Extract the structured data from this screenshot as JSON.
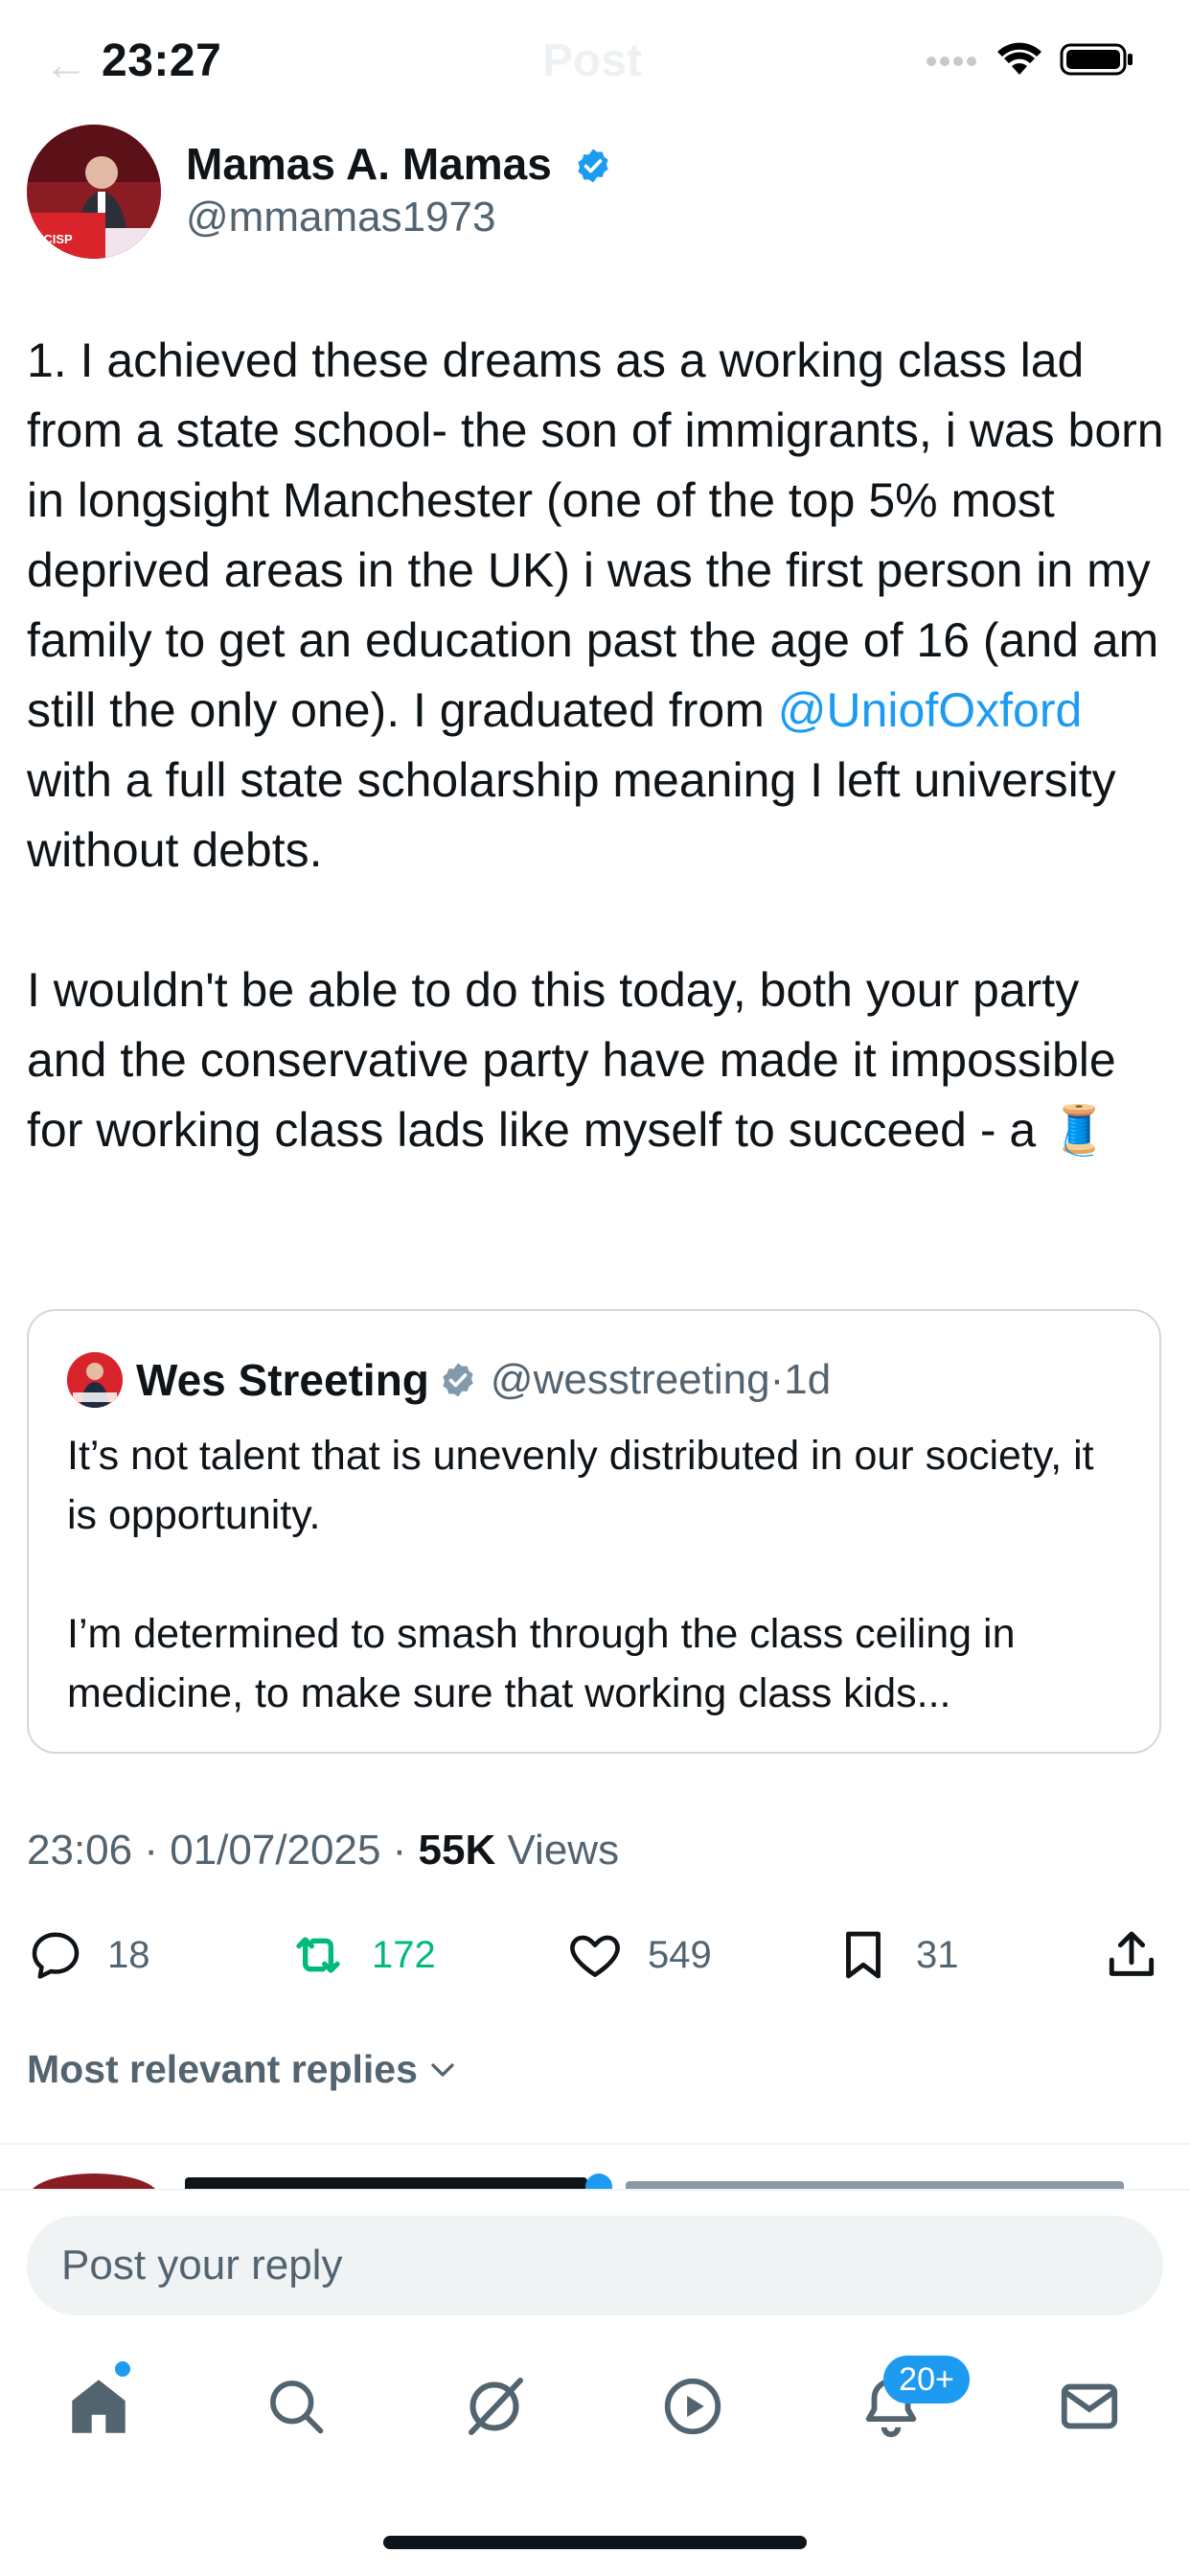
{
  "status_bar": {
    "time": "23:27",
    "ghost_title": "Post",
    "icons": [
      "signal-icon",
      "wifi-icon",
      "battery-icon"
    ]
  },
  "author": {
    "name": "Mamas A. Mamas",
    "handle": "@mmamas1973",
    "verified": true,
    "avatar_podium_text": "BCISP"
  },
  "tweet": {
    "paragraph1_before": "1. I achieved these dreams as a working class lad from a state school- the son of immigrants, i was born in longsight Manchester (one of the top 5% most deprived areas in the UK) i was the first person in my family to get an education past the age of 16 (and am still the only one). I graduated from ",
    "mention": "@UniofOxford",
    "paragraph1_after": " with a full state scholarship meaning I left university without debts.",
    "paragraph2": "I wouldn't be able to do this today, both your party and the conservative party have made it impossible for working class lads like myself to succeed - a ",
    "emoji": "🧵"
  },
  "quote": {
    "name": "Wes Streeting",
    "handle": "@wesstreeting",
    "dot": "·",
    "time": "1d",
    "paragraph1": "It’s not talent that is unevenly distributed in our society, it is opportunity.",
    "paragraph2": "I’m determined to smash through the class ceiling in medicine, to make sure that working class kids..."
  },
  "meta": {
    "time": "23:06",
    "sep1": " · ",
    "date": "01/07/2025",
    "sep2": " · ",
    "views_count": "55K",
    "views_label": " Views"
  },
  "actions": {
    "replies": "18",
    "reposts": "172",
    "likes": "549",
    "bookmarks": "31"
  },
  "replies_sort": {
    "label": "Most relevant replies"
  },
  "reply_bar": {
    "placeholder": "Post your reply"
  },
  "tabs": {
    "items": [
      "home-icon",
      "search-icon",
      "grok-icon",
      "video-icon",
      "notifications-icon",
      "messages-icon"
    ],
    "notifications_badge": "20+"
  },
  "colors": {
    "accent": "#1d9bf0",
    "repost_active": "#00ba7c",
    "secondary_text": "#536471",
    "primary_text": "#0f1419"
  }
}
